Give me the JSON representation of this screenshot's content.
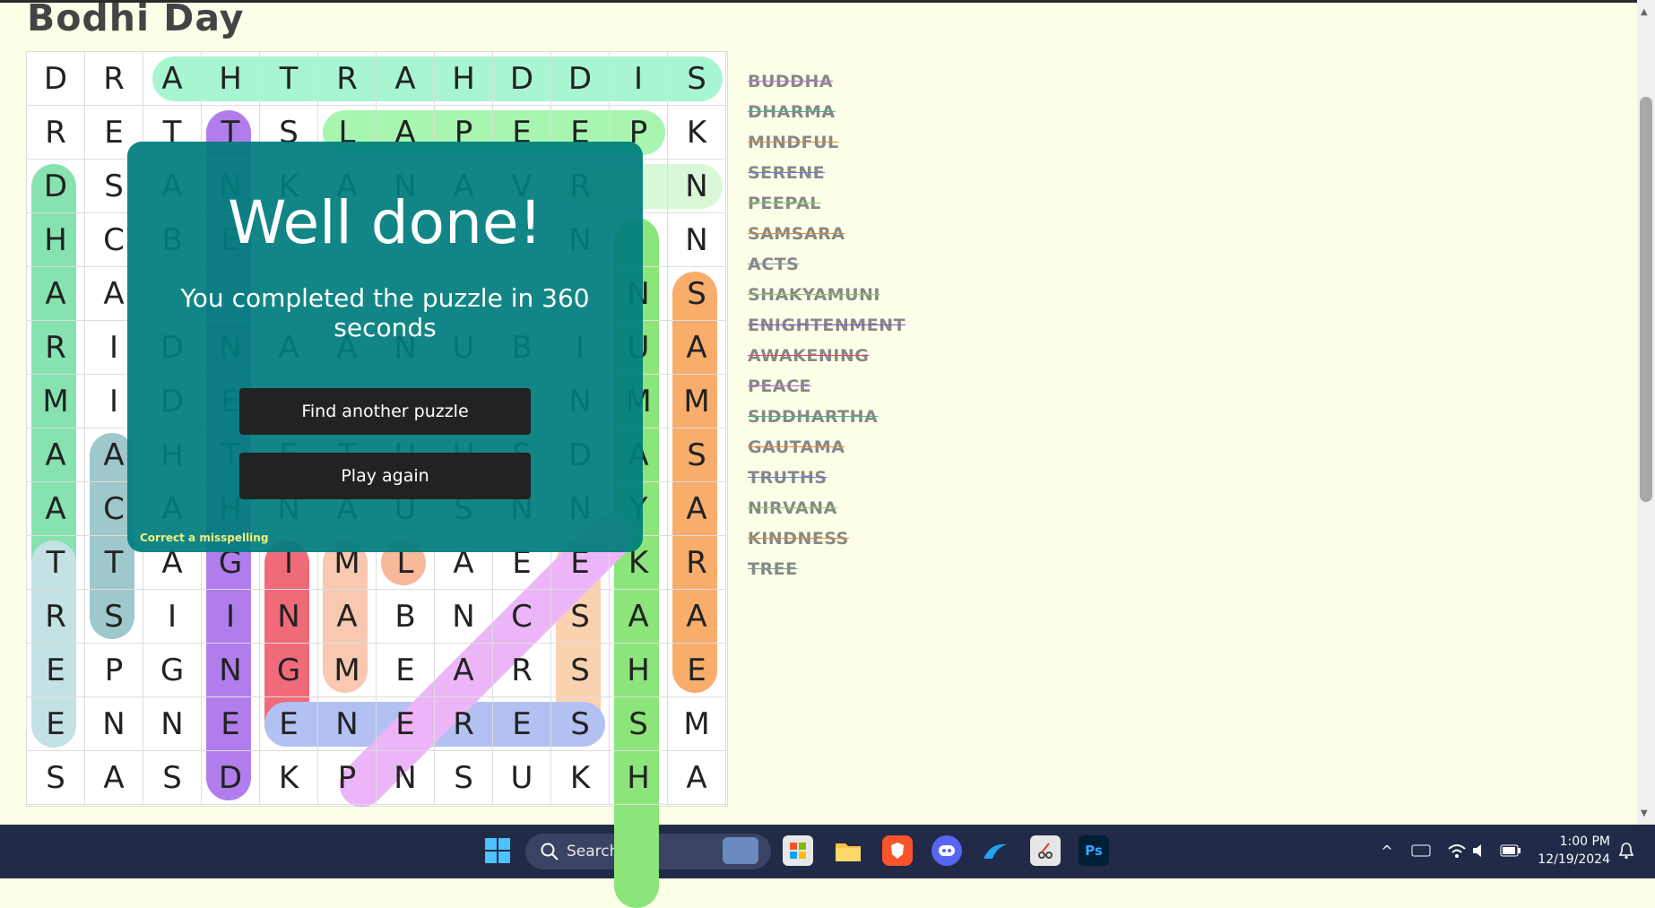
{
  "page": {
    "title": "Bodhi Day"
  },
  "grid": [
    [
      "D",
      "R",
      "A",
      "H",
      "T",
      "R",
      "A",
      "H",
      "D",
      "D",
      "I",
      "S"
    ],
    [
      "R",
      "E",
      "T",
      "T",
      "S",
      "L",
      "A",
      "P",
      "E",
      "E",
      "P",
      "K"
    ],
    [
      "D",
      "S",
      "A",
      "N",
      "K",
      "A",
      "N",
      "A",
      "V",
      "R",
      "",
      "N"
    ],
    [
      "H",
      "C",
      "B",
      "E",
      "",
      "",
      "",
      "",
      "",
      "N",
      "",
      "N"
    ],
    [
      "A",
      "A",
      "",
      "",
      "",
      "",
      "",
      "",
      "",
      "",
      "N",
      "S"
    ],
    [
      "R",
      "I",
      "D",
      "N",
      "A",
      "A",
      "N",
      "U",
      "B",
      "I",
      "U",
      "A"
    ],
    [
      "M",
      "I",
      "D",
      "E",
      "",
      "",
      "",
      "",
      "",
      "N",
      "M",
      "M"
    ],
    [
      "A",
      "A",
      "H",
      "T",
      "E",
      "T",
      "U",
      "H",
      "S",
      "D",
      "A",
      "S"
    ],
    [
      "A",
      "C",
      "A",
      "H",
      "N",
      "A",
      "U",
      "S",
      "N",
      "N",
      "Y",
      "A"
    ],
    [
      "T",
      "T",
      "A",
      "G",
      "I",
      "M",
      "L",
      "A",
      "E",
      "E",
      "K",
      "R"
    ],
    [
      "R",
      "S",
      "I",
      "I",
      "N",
      "A",
      "B",
      "N",
      "C",
      "S",
      "A",
      "A"
    ],
    [
      "E",
      "P",
      "G",
      "N",
      "G",
      "M",
      "E",
      "A",
      "R",
      "S",
      "H",
      "E"
    ],
    [
      "E",
      "N",
      "N",
      "E",
      "E",
      "N",
      "E",
      "R",
      "E",
      "S",
      "S",
      "M"
    ],
    [
      "S",
      "A",
      "S",
      "D",
      "K",
      "P",
      "N",
      "S",
      "U",
      "K",
      "H",
      "A"
    ]
  ],
  "words": [
    "BUDDHA",
    "DHARMA",
    "MINDFUL",
    "SERENE",
    "PEEPAL",
    "SAMSARA",
    "ACTS",
    "SHAKYAMUNI",
    "ENIGHTENMENT",
    "AWAKENING",
    "PEACE",
    "SIDDHARTHA",
    "GAUTAMA",
    "TRUTHS",
    "NIRVANA",
    "KINDNESS",
    "TREE"
  ],
  "word_colors": [
    "#c06ad0",
    "#3bb88a",
    "#e08a3b",
    "#6b7fd0",
    "#8bd06b",
    "#e08a3b",
    "#6aa0a8",
    "#8bd06b",
    "#8a4ad0",
    "#e04a60",
    "#c06ad0",
    "#3bb88a",
    "#e08a3b",
    "#6b7fd0",
    "#8bd06b",
    "#e08a3b",
    "#6aa0a8"
  ],
  "modal": {
    "title": "Well done!",
    "subtitle": "You completed the puzzle in 360 seconds",
    "find_another": "Find another puzzle",
    "play_again": "Play again",
    "misspelling": "Correct a misspelling"
  },
  "taskbar": {
    "search": "Search",
    "time": "1:00 PM",
    "date": "12/19/2024"
  },
  "colors": {
    "background": "#fdfee8",
    "modal": "#007d7d",
    "taskbar": "#212a47"
  }
}
